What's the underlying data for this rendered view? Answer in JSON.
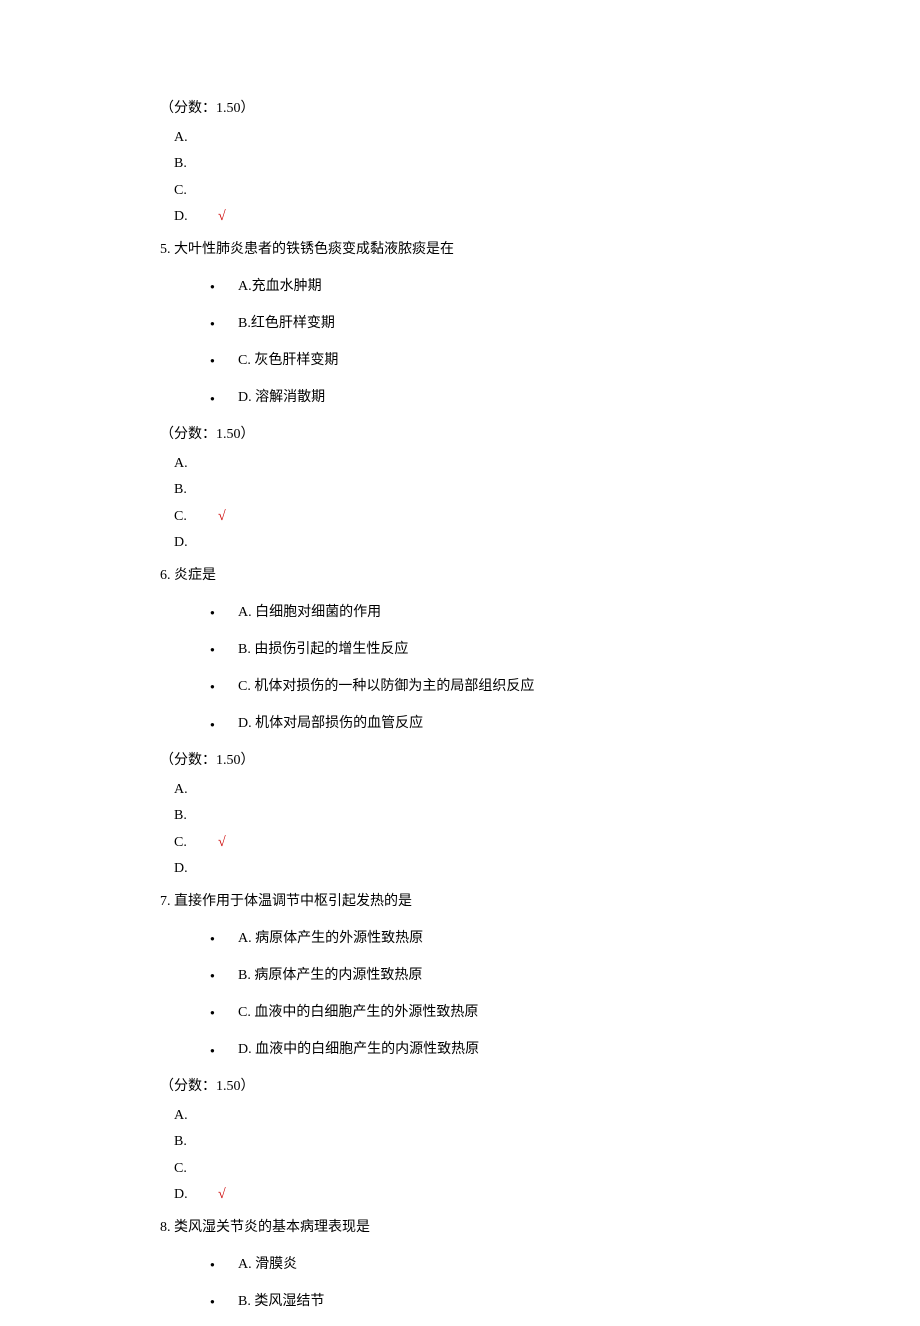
{
  "score_label_prefix": "（分数：",
  "score_label_suffix": "）",
  "score_value": "1.50",
  "letters": {
    "a": "A.",
    "b": "B.",
    "c": "C.",
    "d": "D."
  },
  "check_mark": "√",
  "q4": {
    "correct": "D"
  },
  "q5": {
    "title": "5. 大叶性肺炎患者的铁锈色痰变成黏液脓痰是在",
    "opts": {
      "a": "A.充血水肿期",
      "b": "B.红色肝样变期",
      "c": "C. 灰色肝样变期",
      "d": "D. 溶解消散期"
    },
    "correct": "C"
  },
  "q6": {
    "title": "6. 炎症是",
    "opts": {
      "a": "A.  白细胞对细菌的作用",
      "b": "B.  由损伤引起的增生性反应",
      "c": "C.  机体对损伤的一种以防御为主的局部组织反应",
      "d": "D.  机体对局部损伤的血管反应"
    },
    "correct": "C"
  },
  "q7": {
    "title": "7. 直接作用于体温调节中枢引起发热的是",
    "opts": {
      "a": "A.  病原体产生的外源性致热原",
      "b": "B.  病原体产生的内源性致热原",
      "c": "C.  血液中的白细胞产生的外源性致热原",
      "d": "D.  血液中的白细胞产生的内源性致热原"
    },
    "correct": "D"
  },
  "q8": {
    "title": "8. 类风湿关节炎的基本病理表现是",
    "opts": {
      "a": "A.  滑膜炎",
      "b": "B.  类风湿结节"
    }
  }
}
